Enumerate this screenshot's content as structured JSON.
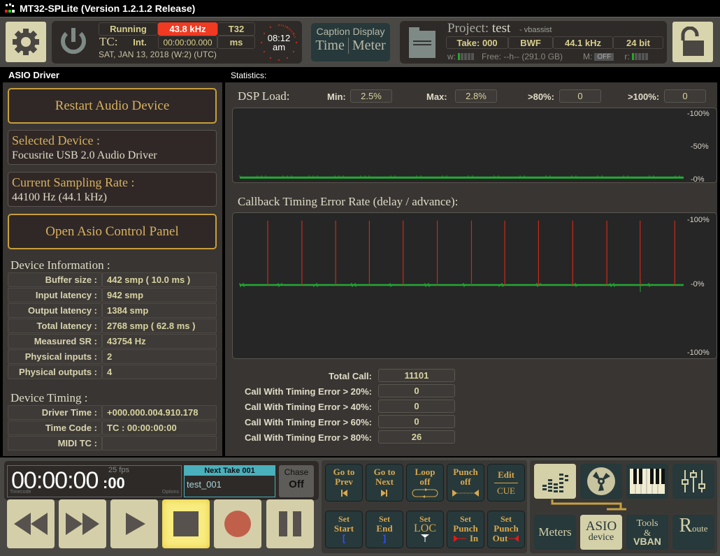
{
  "window": {
    "title": "MT32-SPLite (Version 1.2.1.2 Release)"
  },
  "topbar": {
    "status": "Running",
    "sample_rate": "43.8 kHz",
    "format": "T32",
    "tc_label": "TC:",
    "tc_source": "Int.",
    "tc_value": "00:00:00.000",
    "unit": "ms",
    "date": "SAT, JAN 13, 2018 (W:2) (UTC)",
    "clock_time": "08:12",
    "clock_ampm": "am",
    "caption_title": "Caption Display",
    "caption_time": "Time",
    "caption_meter": "Meter",
    "project_label": "Project:",
    "project_name": "test",
    "project_user": "- vbassist",
    "take": "Take: 000",
    "file_format": "BWF",
    "rate": "44.1 kHz",
    "bits": "24 bit",
    "w_label": "w:",
    "free": "Free: --h-- (291.0 GB)",
    "m_label": "M:",
    "m_state": "OFF",
    "r_label": "r:"
  },
  "asio": {
    "header": "ASIO Driver",
    "restart_button": "Restart Audio Device",
    "selected_label": "Selected Device :",
    "selected_value": "Focusrite USB 2.0 Audio Driver",
    "rate_label": "Current Sampling Rate :",
    "rate_value": "44100 Hz (44.1 kHz)",
    "panel_button": "Open Asio Control Panel",
    "info_title": "Device Information :",
    "info": [
      {
        "k": "Buffer size :",
        "v": "442 smp ( 10.0 ms )"
      },
      {
        "k": "Input latency :",
        "v": "942 smp"
      },
      {
        "k": "Output latency :",
        "v": "1384 smp"
      },
      {
        "k": "Total latency :",
        "v": "2768 smp ( 62.8 ms )"
      },
      {
        "k": "Measured SR :",
        "v": "43754 Hz"
      },
      {
        "k": "Physical inputs :",
        "v": "2"
      },
      {
        "k": "Physical outputs :",
        "v": "4"
      }
    ],
    "timing_title": "Device Timing :",
    "timing": [
      {
        "k": "Driver Time :",
        "v": "+000.000.004.910.178"
      },
      {
        "k": "Time Code :",
        "v": "TC : 00:00:00:00"
      },
      {
        "k": "MIDI TC :",
        "v": ""
      }
    ]
  },
  "stats": {
    "header": "Statistics:",
    "dsp_label": "DSP Load:",
    "min_label": "Min:",
    "min": "2.5%",
    "max_label": "Max:",
    "max": "2.8%",
    "gt80_label": ">80%:",
    "gt80": "0",
    "gt100_label": ">100%:",
    "gt100": "0",
    "callback_label": "Callback Timing Error Rate (delay / advance):",
    "totals": [
      {
        "k": "Total Call:",
        "v": "11101"
      },
      {
        "k": "Call With Timing Error > 20%:",
        "v": "0"
      },
      {
        "k": "Call With Timing Error > 40%:",
        "v": "0"
      },
      {
        "k": "Call With Timing Error > 60%:",
        "v": "0"
      },
      {
        "k": "Call With Timing Error > 80%:",
        "v": "26"
      }
    ]
  },
  "chart_data": [
    {
      "type": "line",
      "title": "DSP Load",
      "ytick_labels": [
        "-100%",
        "-50%",
        "-0%"
      ],
      "ylim": [
        0,
        100
      ],
      "series": [
        {
          "name": "dsp load",
          "color": "#22aa33",
          "approx_value_percent": 2.6
        }
      ]
    },
    {
      "type": "line",
      "title": "Callback Timing Error Rate (delay / advance)",
      "ytick_labels": [
        "-100%",
        "-0%",
        "-100%"
      ],
      "ylim": [
        -100,
        100
      ],
      "series": [
        {
          "name": "timing error",
          "color": "#22aa33",
          "approx_value_percent": 0
        },
        {
          "name": "error spikes",
          "color": "#cc2a1a",
          "spike_positions_fraction": [
            0.063,
            0.14,
            0.216,
            0.292,
            0.368,
            0.445,
            0.522,
            0.597,
            0.673,
            0.75,
            0.827,
            0.902,
            0.98
          ],
          "spike_value_percent": 97
        }
      ]
    }
  ],
  "transport": {
    "timecode": "00:00:00",
    "frames": ":00",
    "fps": "25 fps",
    "tc_caption": "Timecode",
    "options": "Options",
    "next_take_label": "Next Take 001",
    "next_take_name": "test_001",
    "chase_label": "Chase",
    "chase_state": "Off"
  },
  "cue": {
    "row1": [
      {
        "l1": "Go to",
        "l2": "Prev"
      },
      {
        "l1": "Go to",
        "l2": "Next"
      },
      {
        "l1": "Loop",
        "l2": "off"
      },
      {
        "l1": "Punch",
        "l2": "off"
      },
      {
        "l1": "Edit",
        "l2": "CUE"
      }
    ],
    "row2": [
      {
        "l1": "Set",
        "l2": "Start",
        "l3": "["
      },
      {
        "l1": "Set",
        "l2": "End",
        "l3": "]"
      },
      {
        "l1": "Set",
        "l2": "LOC"
      },
      {
        "l1": "Set",
        "l2": "Punch",
        "l3": "In"
      },
      {
        "l1": "Set",
        "l2": "Punch",
        "l3": "Out"
      }
    ]
  },
  "nav": {
    "meters": "Meters",
    "asio1": "ASIO",
    "asio2": "device",
    "tools1": "Tools",
    "tools2": "&",
    "tools3": "VBAN",
    "route_big": "R",
    "route_small": "oute"
  }
}
